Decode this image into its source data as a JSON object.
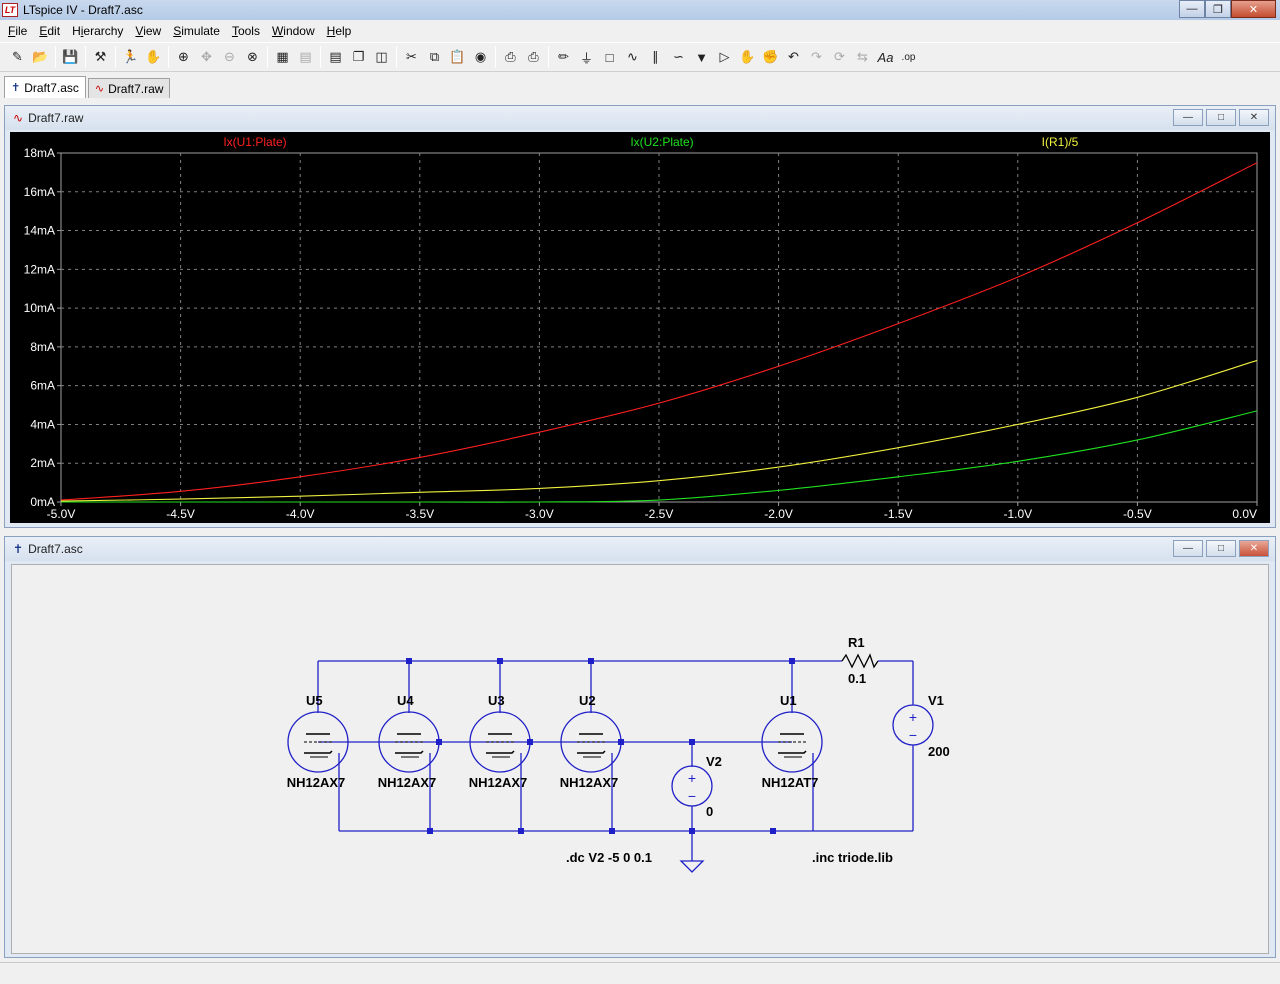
{
  "window": {
    "title": "LTspice IV - Draft7.asc",
    "app_icon_text": "LT"
  },
  "menu": [
    {
      "label": "File",
      "key": "F"
    },
    {
      "label": "Edit",
      "key": "E"
    },
    {
      "label": "Hierarchy",
      "key": "i"
    },
    {
      "label": "View",
      "key": "V"
    },
    {
      "label": "Simulate",
      "key": "S"
    },
    {
      "label": "Tools",
      "key": "T"
    },
    {
      "label": "Window",
      "key": "W"
    },
    {
      "label": "Help",
      "key": "H"
    }
  ],
  "toolbar": [
    "new-schematic-icon",
    "open-icon",
    "sep",
    "save-icon",
    "sep",
    "control-panel-icon",
    "sep",
    "run-icon",
    "halt-icon",
    "sep",
    "zoom-in-icon",
    "pan-icon",
    "zoom-out-icon",
    "zoom-fit-icon",
    "sep",
    "autorange-icon",
    "add-trace-icon",
    "sep",
    "tile-horizontal-icon",
    "cascade-icon",
    "tile-vertical-icon",
    "sep",
    "cut-icon",
    "copy-icon",
    "paste-icon",
    "find-icon",
    "sep",
    "print-setup-icon",
    "print-icon",
    "sep",
    "draw-wire-icon",
    "ground-icon",
    "label-net-icon",
    "resistor-icon",
    "capacitor-icon",
    "inductor-icon",
    "diode-icon",
    "component-icon",
    "move-icon",
    "drag-icon",
    "undo-icon",
    "redo-icon",
    "rotate-icon",
    "mirror-icon",
    "text-icon",
    "spice-directive-icon"
  ],
  "tabs": [
    {
      "label": "Draft7.asc",
      "icon": "schematic-icon",
      "active": true
    },
    {
      "label": "Draft7.raw",
      "icon": "waveform-icon",
      "active": false
    }
  ],
  "waveform_panel": {
    "title": "Draft7.raw"
  },
  "schematic_panel": {
    "title": "Draft7.asc"
  },
  "chart_data": {
    "type": "line",
    "x": [
      -5.0,
      -4.5,
      -4.0,
      -3.5,
      -3.0,
      -2.5,
      -2.0,
      -1.5,
      -1.0,
      -0.5,
      0.0
    ],
    "xlim": [
      -5.0,
      0.0
    ],
    "ylim": [
      0,
      18
    ],
    "xticks": [
      "-5.0V",
      "-4.5V",
      "-4.0V",
      "-3.5V",
      "-3.0V",
      "-2.5V",
      "-2.0V",
      "-1.5V",
      "-1.0V",
      "-0.5V",
      "0.0V"
    ],
    "yticks": [
      "0mA",
      "2mA",
      "4mA",
      "6mA",
      "8mA",
      "10mA",
      "12mA",
      "14mA",
      "16mA",
      "18mA"
    ],
    "grid": true,
    "series": [
      {
        "name": "Ix(U1:Plate)",
        "color": "#ff2020",
        "values": [
          0.1,
          0.55,
          1.3,
          2.3,
          3.6,
          5.1,
          7.0,
          9.2,
          11.6,
          14.4,
          17.5
        ]
      },
      {
        "name": "Ix(U2:Plate)",
        "color": "#20e020",
        "values": [
          0.0,
          0.0,
          0.0,
          0.0,
          0.0,
          0.1,
          0.6,
          1.3,
          2.1,
          3.2,
          4.7
        ]
      },
      {
        "name": "I(R1)/5",
        "color": "#f0f040",
        "values": [
          0.05,
          0.15,
          0.3,
          0.5,
          0.7,
          1.1,
          1.8,
          2.8,
          4.0,
          5.4,
          7.3
        ]
      }
    ]
  },
  "schematic": {
    "wire_color": "#2020c8",
    "tubes": [
      {
        "ref": "U5",
        "model": "NH12AX7"
      },
      {
        "ref": "U4",
        "model": "NH12AX7"
      },
      {
        "ref": "U3",
        "model": "NH12AX7"
      },
      {
        "ref": "U2",
        "model": "NH12AX7"
      },
      {
        "ref": "U1",
        "model": "NH12AT7"
      }
    ],
    "r1": {
      "ref": "R1",
      "value": "0.1"
    },
    "v1": {
      "ref": "V1",
      "value": "200"
    },
    "v2": {
      "ref": "V2",
      "value": "0"
    },
    "directives": [
      ".dc V2 -5 0 0.1",
      ".inc triode.lib"
    ]
  }
}
